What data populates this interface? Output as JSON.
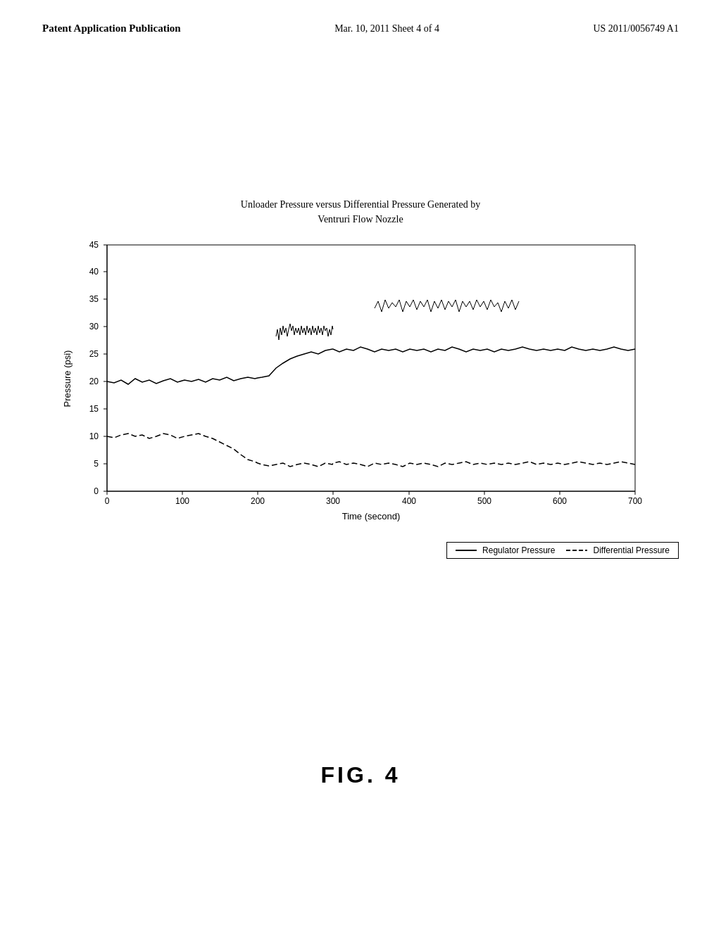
{
  "header": {
    "left": "Patent Application Publication",
    "center": "Mar. 10, 2011  Sheet 4 of 4",
    "right": "US 2011/0056749 A1"
  },
  "chart": {
    "title_line1": "Unloader Pressure versus Differential Pressure Generated by",
    "title_line2": "Ventruri Flow Nozzle",
    "y_axis_label": "Pressure (psi)",
    "x_axis_label": "Time (second)",
    "y_ticks": [
      "0",
      "5",
      "10",
      "15",
      "20",
      "25",
      "30",
      "35",
      "40",
      "45"
    ],
    "x_ticks": [
      "0",
      "100",
      "200",
      "300",
      "400",
      "500",
      "600",
      "700"
    ],
    "legend_item1": "——Regulator Pressure",
    "legend_item2": "—— Differential Pressure"
  },
  "figure_label": "FIG. 4"
}
